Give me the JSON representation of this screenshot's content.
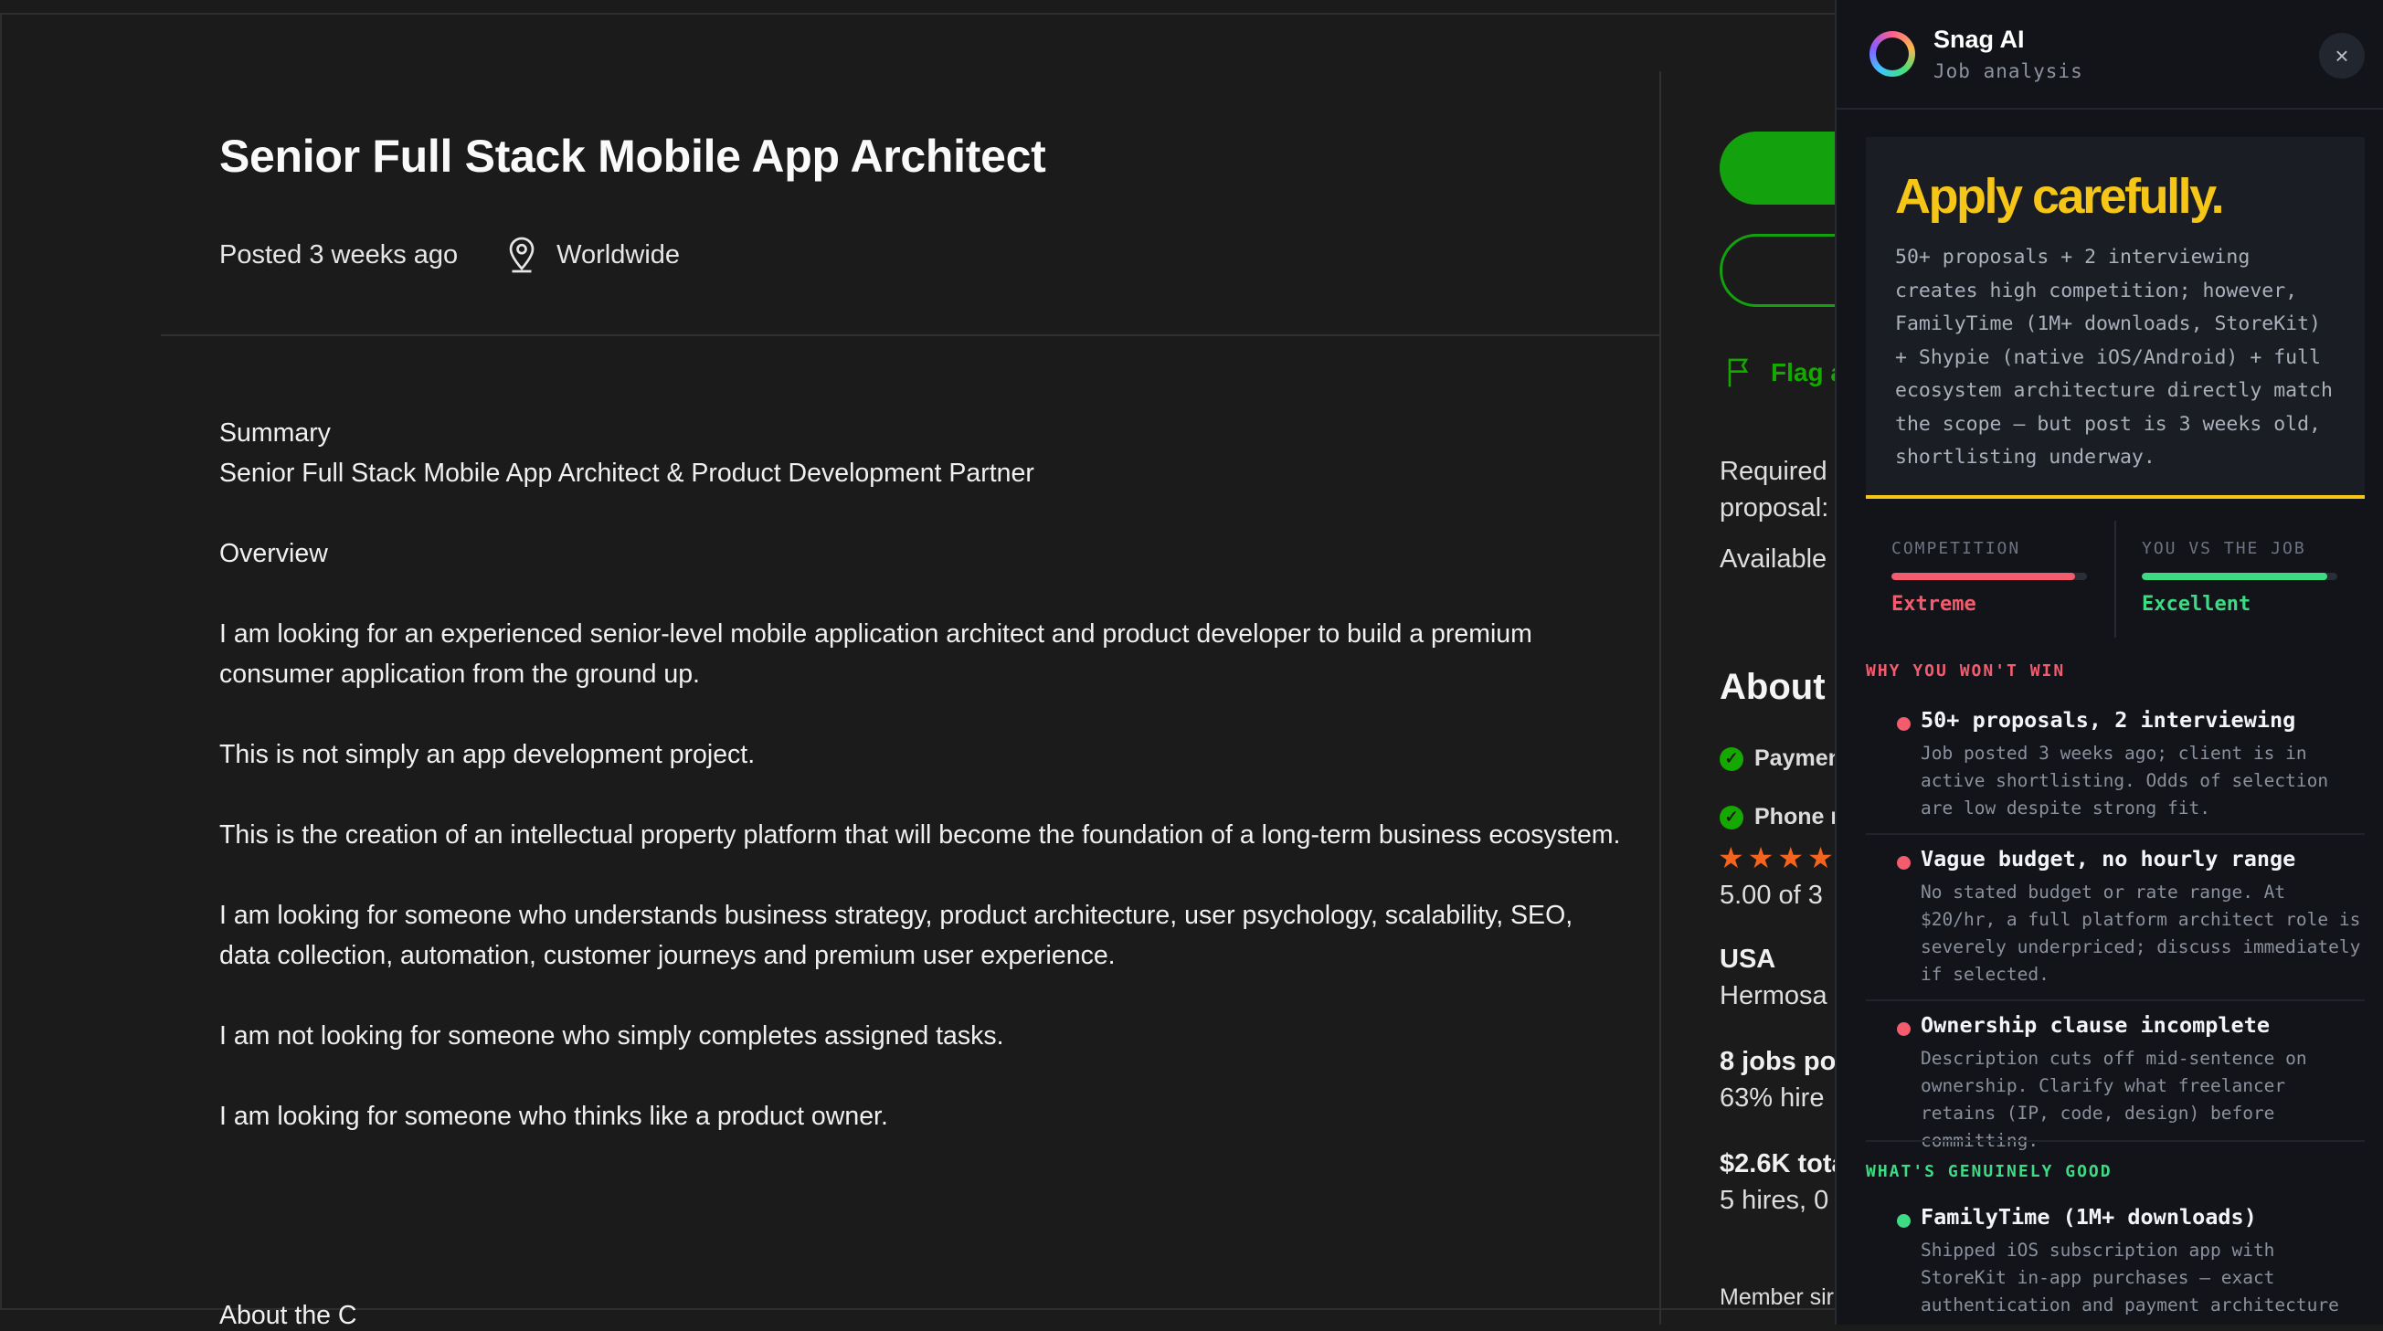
{
  "job": {
    "title": "Senior Full Stack Mobile App Architect",
    "posted": "Posted 3 weeks ago",
    "location": "Worldwide",
    "description": [
      "Summary",
      "Senior Full Stack Mobile App Architect & Product Development Partner",
      "Overview",
      "I am looking for an experienced senior-level mobile application architect and product developer to build a premium consumer application from the ground up.",
      "This is not simply an app development project.",
      "This is the creation of an intellectual property platform that will become the foundation of a long-term business ecosystem.",
      "I am looking for someone who understands business strategy, product architecture, user psychology, scalability, SEO, data collection, automation, customer journeys and premium user experience.",
      "I am not looking for someone who simply completes assigned tasks.",
      "I am looking for someone who thinks like a product owner."
    ],
    "cutoff_heading": "About the C"
  },
  "sidebar": {
    "flag_label": "Flag a",
    "required_line1": "Required",
    "required_line2": "proposal:",
    "available": "Available (",
    "about_heading": "About t",
    "payment": "Paymen",
    "phone": "Phone n",
    "rating": "5.00 of 3",
    "country": "USA",
    "city": "Hermosa",
    "jobs_posted": "8 jobs pos",
    "hire_rate": "63% hire",
    "total_spent": "$2.6K tota",
    "hires": "5 hires, 0",
    "member_since": "Member sir"
  },
  "panel": {
    "brand": "Snag AI",
    "subtitle": "Job analysis",
    "close_icon": "×",
    "verdict_title": "Apply carefully.",
    "verdict_body": "50+ proposals + 2 interviewing creates high competition; however, FamilyTime (1M+ downloads, StoreKit) + Shypie (native iOS/Android) + full ecosystem architecture directly match the scope — but post is 3 weeks old, shortlisting underway.",
    "competition_label": "COMPETITION",
    "competition_value": "Extreme",
    "competition_level": 0.94,
    "fit_label": "YOU VS THE JOB",
    "fit_value": "Excellent",
    "fit_level": 0.95,
    "why_heading": "WHY YOU WON'T WIN",
    "why_items": [
      {
        "title": "50+ proposals, 2 interviewing",
        "body": "Job posted 3 weeks ago; client is in active shortlisting. Odds of selection are low despite strong fit."
      },
      {
        "title": "Vague budget, no hourly range",
        "body": "No stated budget or rate range. At $20/hr, a full platform architect role is severely underpriced; discuss immediately if selected."
      },
      {
        "title": "Ownership clause incomplete",
        "body": "Description cuts off mid-sentence on ownership. Clarify what freelancer retains (IP, code, design) before committing."
      }
    ],
    "good_heading": "WHAT'S GENUINELY GOOD",
    "good_items": [
      {
        "title": "FamilyTime (1M+ downloads)",
        "body": "Shipped iOS subscription app with StoreKit in-app purchases — exact authentication and payment architecture"
      }
    ],
    "colors": {
      "red": "#f25c6e",
      "green": "#3ddc84",
      "yellow": "#f5c518"
    }
  }
}
